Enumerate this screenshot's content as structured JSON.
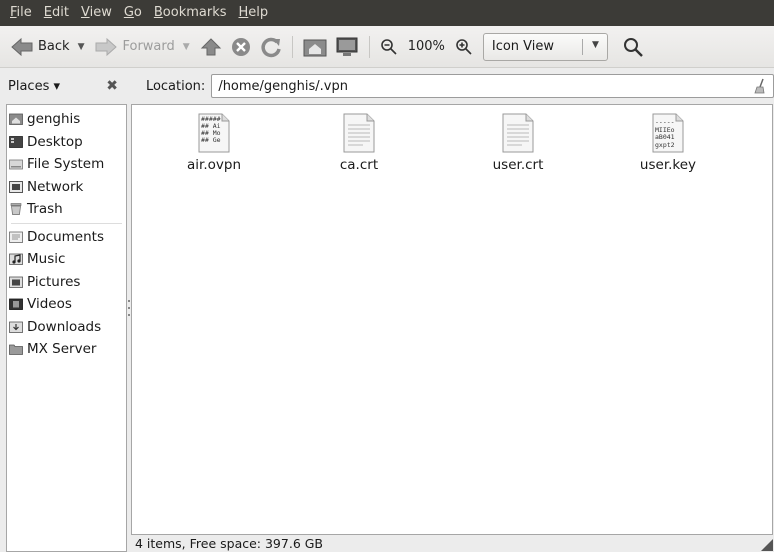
{
  "menu": {
    "file": {
      "acc": "F",
      "rest": "ile"
    },
    "edit": {
      "acc": "E",
      "rest": "dit"
    },
    "view": {
      "acc": "V",
      "rest": "iew"
    },
    "go": {
      "acc": "G",
      "rest": "o"
    },
    "bookmarks": {
      "acc": "B",
      "rest": "ookmarks"
    },
    "help": {
      "acc": "H",
      "rest": "elp"
    }
  },
  "toolbar": {
    "back_label": "Back",
    "forward_label": "Forward",
    "zoom_level": "100%",
    "view_mode": "Icon View"
  },
  "places": {
    "label": "Places ▾",
    "close": "✖"
  },
  "location": {
    "label": "Location:",
    "path": "/home/genghis/.vpn"
  },
  "sidebar": {
    "items": [
      {
        "label": "genghis",
        "icon": "home-folder-icon"
      },
      {
        "label": "Desktop",
        "icon": "desktop-icon"
      },
      {
        "label": "File System",
        "icon": "harddisk-icon"
      },
      {
        "label": "Network",
        "icon": "network-icon"
      },
      {
        "label": "Trash",
        "icon": "trash-icon"
      }
    ],
    "bookmarks": [
      {
        "label": "Documents",
        "icon": "documents-folder-icon"
      },
      {
        "label": "Music",
        "icon": "music-folder-icon"
      },
      {
        "label": "Pictures",
        "icon": "pictures-folder-icon"
      },
      {
        "label": "Videos",
        "icon": "videos-folder-icon"
      },
      {
        "label": "Downloads",
        "icon": "downloads-folder-icon"
      },
      {
        "label": "MX Server",
        "icon": "folder-icon"
      }
    ]
  },
  "files": [
    {
      "name": "air.ovpn",
      "preview": [
        "#####",
        "## Ai",
        "## Mo",
        "## Ge"
      ]
    },
    {
      "name": "ca.crt",
      "preview": []
    },
    {
      "name": "user.crt",
      "preview": []
    },
    {
      "name": "user.key",
      "preview": [
        "-----",
        "MIIEo",
        "aB041",
        "gxpt2"
      ]
    }
  ],
  "status": "4 items, Free space: 397.6 GB"
}
